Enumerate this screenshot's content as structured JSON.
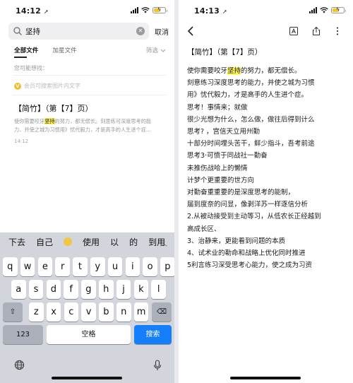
{
  "left": {
    "status": {
      "time": "14:12"
    },
    "search": {
      "query": "坚持",
      "cancel_label": "取消"
    },
    "tabs": [
      {
        "label": "全部文件",
        "active": true
      },
      {
        "label": "加星文件",
        "active": false
      }
    ],
    "filter_label": "筛选",
    "hint": "您可能想找：",
    "tip": "会员可搜索图片内文字",
    "result": {
      "title": "【简竹】（第【7】页）",
      "snippet1_pre": "使你需要咬牙",
      "snippet1_hl": "坚持",
      "snippet1_post": "的努力，都无偿长。刻意练可深度思考的能",
      "snippet2": "力、并使之城为习惯用》忧代毅力，才是高手的人生进个症...",
      "date": "14:12"
    },
    "keyboard": {
      "suggestions": [
        "下去",
        "自己",
        "使用",
        "以",
        "的",
        "到用"
      ],
      "row1": [
        "q",
        "w",
        "e",
        "r",
        "t",
        "y",
        "u",
        "i",
        "o",
        "p"
      ],
      "row2": [
        "a",
        "s",
        "d",
        "f",
        "g",
        "h",
        "j",
        "k",
        "l"
      ],
      "row3": [
        "z",
        "x",
        "c",
        "v",
        "b",
        "n",
        "m"
      ],
      "shift": "⇧",
      "delete": "⌫",
      "num_key": "123",
      "space_label": "空格",
      "search_label": "搜索"
    }
  },
  "right": {
    "status": {
      "time": "14:13"
    },
    "doc": {
      "title": "【简竹】（第【7】页）",
      "line1_pre": "使你需要咬牙",
      "line1_hl": "坚持",
      "line1_post": "的努力，都无偿长。",
      "lines": [
        "刻意练习深度思考的能力，并使之城为习惯",
        "用》忧代毅力，才是高手的人生进个症。",
        "思考！事情来；就做",
        "很少光想为什么，怎么做，做往后得到计么",
        "思考? ，宫信天立用州勤",
        "十部分时间埋头苦干，鲜少指斗，吾考前途",
        "思考3·可愤于同战社一勤奋",
        "未推伤战哈上的懒情",
        "计梦个更重要的世方向",
        "对勤奋重重要的是深度思考的能制，",
        "届到度奈的问显，像剥洋苏一样逐信分析",
        "2.从被动接受到主动等习，从低农长正经越到",
        "高成长区、",
        "3、治静来，更能看到问题的本质",
        "4、试术业的勒命和战略上优化同时推进",
        "5利言练习深受思考心能力，使之成为习资"
      ]
    }
  }
}
